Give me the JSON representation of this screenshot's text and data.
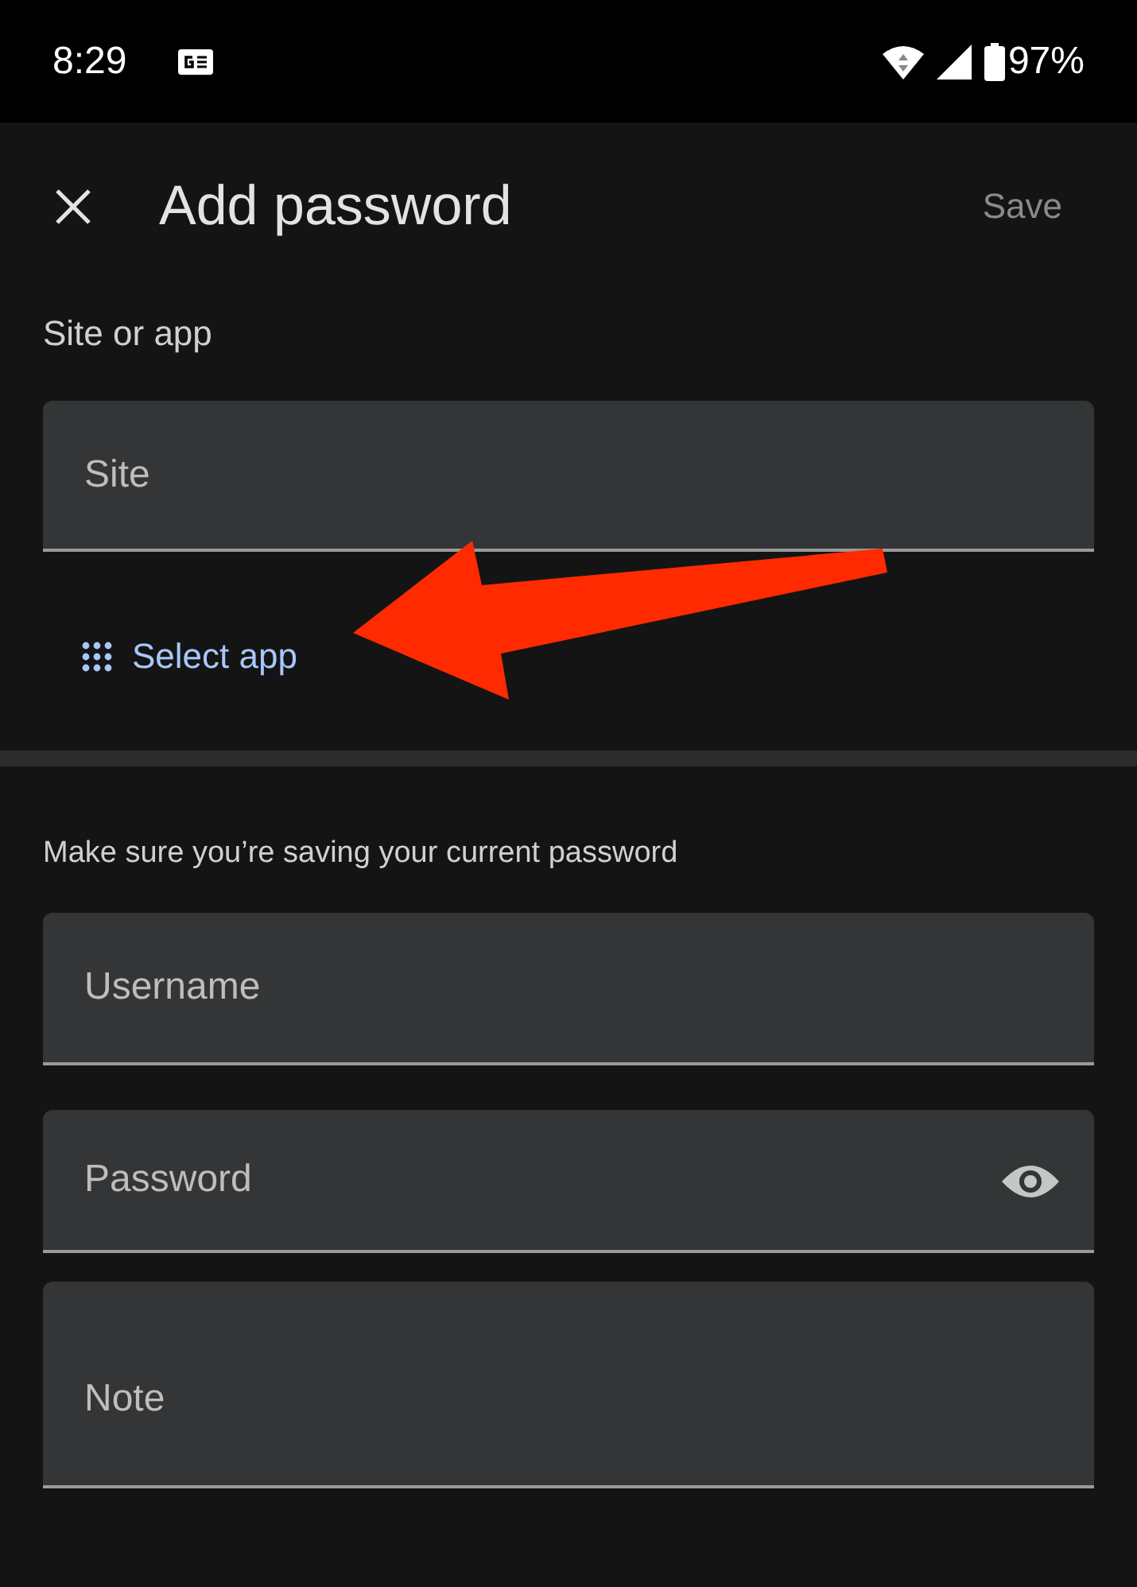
{
  "status_bar": {
    "time": "8:29",
    "battery": "97%"
  },
  "app_bar": {
    "title": "Add password",
    "save": {
      "label": "Save",
      "disabled": true
    }
  },
  "site_section": {
    "label": "Site or app",
    "field": {
      "placeholder": "Site"
    },
    "select_app": "Select app"
  },
  "credentials_section": {
    "hint": "Make sure you’re saving your current password",
    "fields": [
      {
        "kind": "text",
        "placeholder": "Username"
      },
      {
        "kind": "password",
        "placeholder": "Password"
      },
      {
        "kind": "note",
        "placeholder": "Note"
      }
    ]
  }
}
